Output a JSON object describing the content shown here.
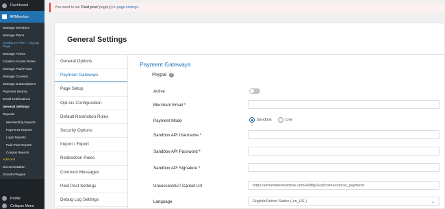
{
  "sidebar": {
    "dashboard": "Dashboard",
    "plugin": "ARMember",
    "items": [
      {
        "label": "Manage Members",
        "style": "normal"
      },
      {
        "label": "Manage Plans",
        "style": "normal"
      },
      {
        "label": "Configure Plan + Signup Page",
        "style": "link"
      },
      {
        "label": "Manage Forms",
        "style": "normal"
      },
      {
        "label": "Content Access Rules",
        "style": "normal"
      },
      {
        "label": "Manage Paid Posts",
        "style": "normal"
      },
      {
        "label": "Manage Courses",
        "style": "normal"
      },
      {
        "label": "Manage Subscriptions",
        "style": "normal"
      },
      {
        "label": "Payment History",
        "style": "normal"
      },
      {
        "label": "Email Notifications",
        "style": "normal"
      },
      {
        "label": "General Settings",
        "style": "current"
      },
      {
        "label": "Reports",
        "style": "normal"
      },
      {
        "label": "Membership Reports",
        "style": "sub"
      },
      {
        "label": "Payments Reports",
        "style": "sub"
      },
      {
        "label": "Login Reports",
        "style": "sub"
      },
      {
        "label": "Paid Post Reports",
        "style": "sub"
      },
      {
        "label": "Coupon Reports",
        "style": "sub"
      },
      {
        "label": "Add-ons",
        "style": "addon"
      },
      {
        "label": "Documentation",
        "style": "normal"
      },
      {
        "label": "Growth Plugins",
        "style": "normal"
      }
    ],
    "profile": "Profile",
    "collapse": "Collapse Menu"
  },
  "notice": {
    "prefix": "You need to set",
    "bold": "'Paid post'",
    "middle": "page(s) in",
    "link": "page settings"
  },
  "panel": {
    "title": "General Settings",
    "tabs": [
      "General Options",
      "Payment Gateways",
      "Page Setup",
      "Opt-ins Configuration",
      "Default Restriction Rules",
      "Security Options",
      "Import / Export",
      "Redirection Rules",
      "Common Messages",
      "Paid Post Settings",
      "Debug Log Settings"
    ],
    "active_tab": "Payment Gateways"
  },
  "content": {
    "section_title": "Payment Gateways",
    "gateway": "Paypal",
    "help_icon": "?",
    "fields": {
      "active": {
        "label": "Active",
        "value": false
      },
      "merchant_email": {
        "label": "Merchant Email *",
        "value": ""
      },
      "payment_mode": {
        "label": "Payment Mode",
        "options": [
          "Sandbox",
          "Live"
        ],
        "selected": "Sandbox"
      },
      "api_username": {
        "label": "Sandbox API Username *",
        "value": ""
      },
      "api_password": {
        "label": "Sandbox API Password *",
        "value": ""
      },
      "api_signature": {
        "label": "Sandbox API Signature *",
        "value": ""
      },
      "cancel_url": {
        "label": "Unsuccessful / Cancel Url",
        "value": "https://armembertestdrive.com/4d8bp2vu8colme/cancel_payment/"
      },
      "language": {
        "label": "Language",
        "value": "English/United States ( en_US )"
      }
    }
  },
  "colors": {
    "accent": "#2271b1",
    "sidebar": "#1d2327",
    "notice_border": "#d63638"
  }
}
